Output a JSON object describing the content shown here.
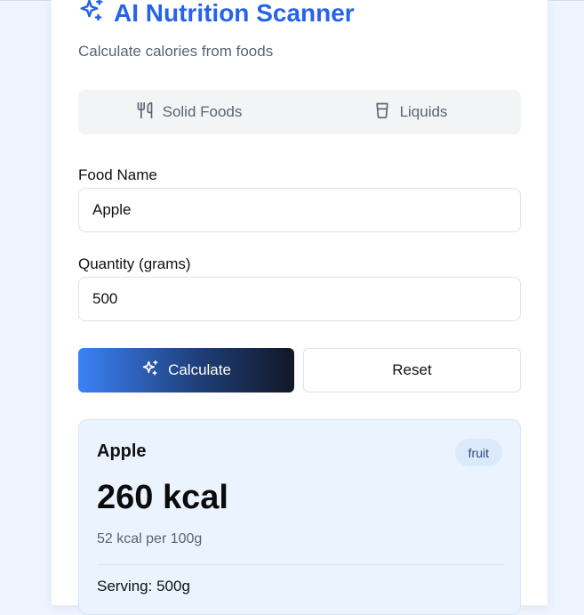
{
  "header": {
    "title": "AI Nutrition Scanner",
    "subtitle": "Calculate calories from foods"
  },
  "tabs": [
    {
      "label": "Solid Foods",
      "icon": "utensils-icon"
    },
    {
      "label": "Liquids",
      "icon": "glass-icon"
    }
  ],
  "form": {
    "food_name_label": "Food Name",
    "food_name_value": "Apple",
    "quantity_label": "Quantity (grams)",
    "quantity_value": "500"
  },
  "buttons": {
    "calculate_label": "Calculate",
    "reset_label": "Reset"
  },
  "result": {
    "name": "Apple",
    "category": "fruit",
    "calories": "260 kcal",
    "per_100g": "52 kcal per 100g",
    "serving": "Serving: 500g"
  },
  "colors": {
    "accent": "#2563eb",
    "background": "#eef4fd",
    "result_background": "#eaf3fe"
  }
}
